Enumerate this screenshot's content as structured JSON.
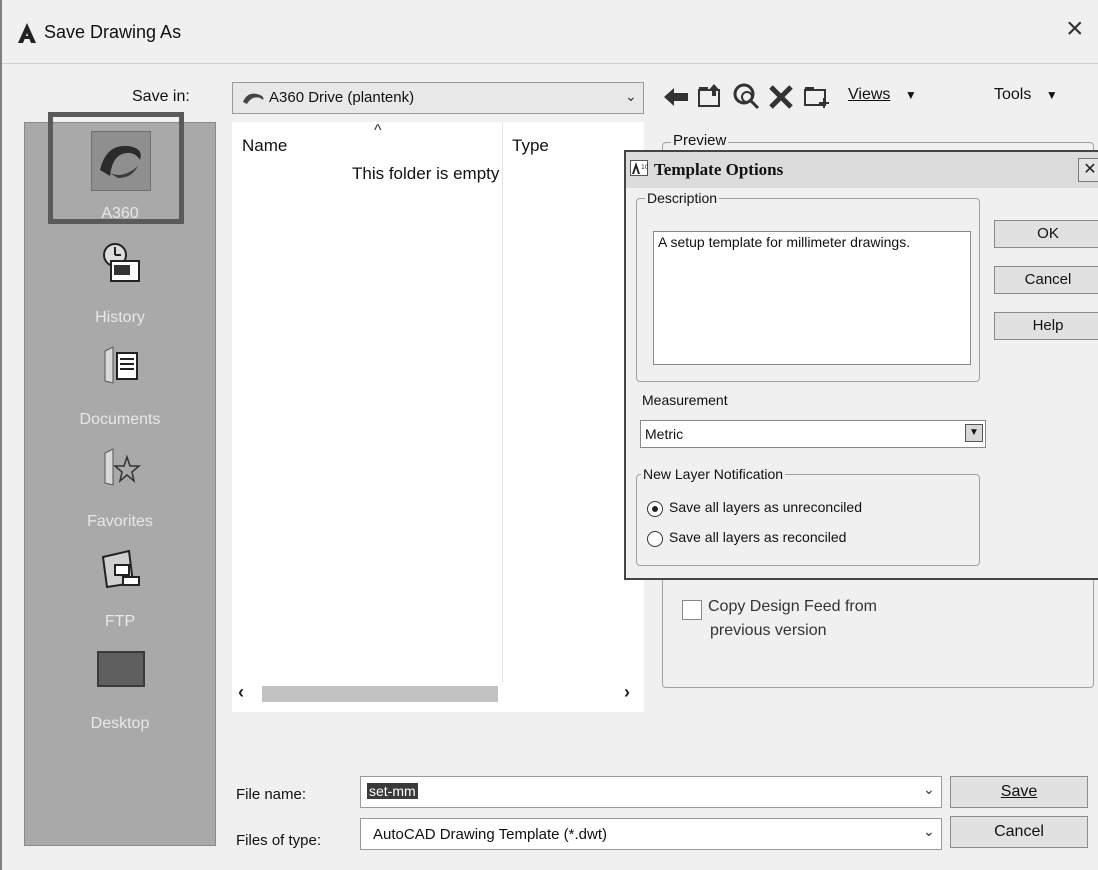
{
  "window": {
    "title": "Save Drawing As",
    "close_glyph": "×"
  },
  "save_in": {
    "label": "Save in:",
    "value": "A360 Drive (plantenk)"
  },
  "toolbar": {
    "views_label": "Views",
    "tools_label": "Tools"
  },
  "places": [
    {
      "label": "A360",
      "icon": "a360-icon"
    },
    {
      "label": "History",
      "icon": "history-icon"
    },
    {
      "label": "Documents",
      "icon": "documents-icon"
    },
    {
      "label": "Favorites",
      "icon": "favorites-icon"
    },
    {
      "label": "FTP",
      "icon": "ftp-icon"
    },
    {
      "label": "Desktop",
      "icon": "desktop-icon"
    }
  ],
  "file_list": {
    "col_name": "Name",
    "col_type": "Type",
    "empty_message": "This folder is empty"
  },
  "preview": {
    "label": "Preview"
  },
  "copy_feed": {
    "line1": "Copy Design Feed from",
    "line2": "previous version"
  },
  "file_name": {
    "label": "File name:",
    "value": "set-mm"
  },
  "file_type": {
    "label": "Files of type:",
    "value": "AutoCAD Drawing Template (*.dwt)"
  },
  "buttons": {
    "save": "Save",
    "cancel": "Cancel"
  },
  "template_options": {
    "title": "Template Options",
    "description_label": "Description",
    "description_value": "A setup template for millimeter drawings.",
    "measurement_label": "Measurement",
    "measurement_value": "Metric",
    "notification_label": "New Layer Notification",
    "option_unreconciled": "Save all layers as unreconciled",
    "option_reconciled": "Save all layers as reconciled",
    "ok": "OK",
    "cancel": "Cancel",
    "help": "Help"
  },
  "colors": {
    "places_bg": "#a9a9a9",
    "highlight_box": "#5a5a5a",
    "selection": "#3a3a3a"
  }
}
